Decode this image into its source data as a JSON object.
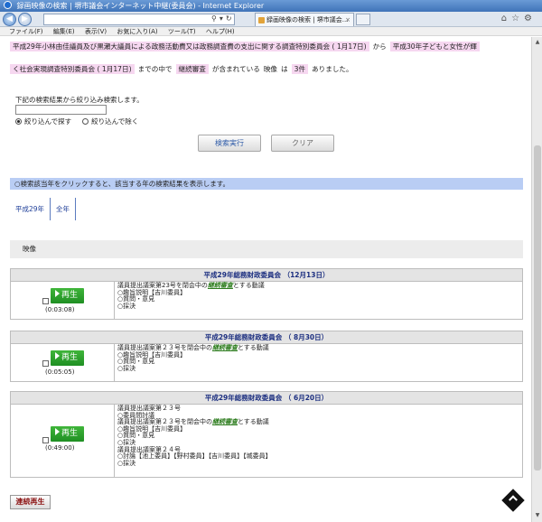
{
  "browser": {
    "window_title": "録画映像の検索 | 堺市議会インターネット中継(委員会) - Internet Explorer",
    "tab_title": "録画映像の検索 | 堺市議会...",
    "menu": [
      "ファイル(F)",
      "編集(E)",
      "表示(V)",
      "お気に入り(A)",
      "ツール(T)",
      "ヘルプ(H)"
    ]
  },
  "summary": {
    "committee1": "平成29年小林由佳議員及び黒瀬大議員による政務活動費又は政務調査費の支出に関する調査特別委員会 ( 1月17日)",
    "from": "から",
    "committee2a": "平成30年子どもと女性が輝",
    "committee2b": "く社会実現調査特別委員会 ( 1月17日)",
    "until": "までの中で",
    "keyword": "継続審査",
    "included": "が含まれている",
    "media": "映像",
    "is": "は",
    "count": "3件",
    "result": "ありました。"
  },
  "filter": {
    "label": "下記の検索結果から絞り込み検索します。",
    "value": "",
    "option_include": "絞り込んで探す",
    "option_exclude": "絞り込んで除く",
    "selected": "include"
  },
  "buttons": {
    "search": "検索実行",
    "clear": "クリア",
    "continuous": "連続再生"
  },
  "notice": "○検索該当年をクリックすると、該当する年の検索結果を表示します。",
  "year_tabs": [
    "平成29年",
    "全年"
  ],
  "section_label": "映像",
  "play_label": "再生",
  "sessions": [
    {
      "title": "平成29年総務財政委員会 （12月13日）",
      "duration": "(0:03:08)",
      "lines": [
        "議員提出議案第23号を閉会中の",
        "継続審査",
        "とする動議",
        "○趣旨説明【吉川委員】",
        "○質問・意見",
        "○採決"
      ]
    },
    {
      "title": "平成29年総務財政委員会 （ 8月30日）",
      "duration": "(0:05:05)",
      "lines": [
        "議員提出議案第２３号を閉会中の",
        "継続審査",
        "とする動議",
        "○趣旨説明【吉川委員】",
        "○質問・意見",
        "○採決"
      ]
    },
    {
      "title": "平成29年総務財政委員会 （ 6月20日）",
      "duration": "(0:49:00)",
      "lines_before": [
        "議員提出議案第２３号",
        "○委員間討議"
      ],
      "lines": [
        "議員提出議案第２３号を閉会中の",
        "継続審査",
        "とする動議",
        "○趣旨説明【吉川委員】",
        "○質問・意見",
        "○採決"
      ],
      "lines_after": [
        "議員提出議案第２４号",
        "○討論【池上委員】【野村委員】【吉川委員】【城委員】",
        "○採決"
      ]
    }
  ]
}
